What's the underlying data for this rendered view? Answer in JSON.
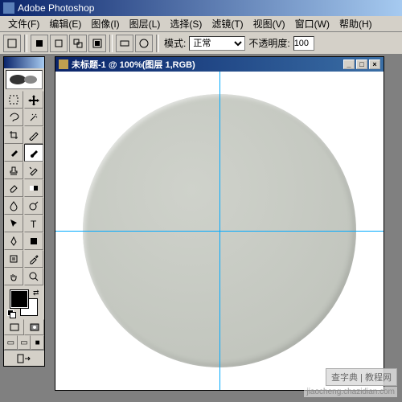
{
  "app": {
    "title": "Adobe Photoshop"
  },
  "menu": {
    "file": "文件(F)",
    "edit": "编辑(E)",
    "image": "图像(I)",
    "layer": "图层(L)",
    "select": "选择(S)",
    "filter": "滤镜(T)",
    "view": "视图(V)",
    "window": "窗口(W)",
    "help": "帮助(H)"
  },
  "options": {
    "mode_label": "模式:",
    "mode_value": "正常",
    "opacity_label": "不透明度:",
    "opacity_value": "100"
  },
  "document": {
    "title": "未标题-1 @ 100%(图层 1,RGB)"
  },
  "watermark": {
    "site": "jiaocheng.chazidian.com",
    "brand": "查字典 | 教程网"
  },
  "colors": {
    "guide": "#00aaff",
    "circle_fill": "#c6c9c2"
  }
}
